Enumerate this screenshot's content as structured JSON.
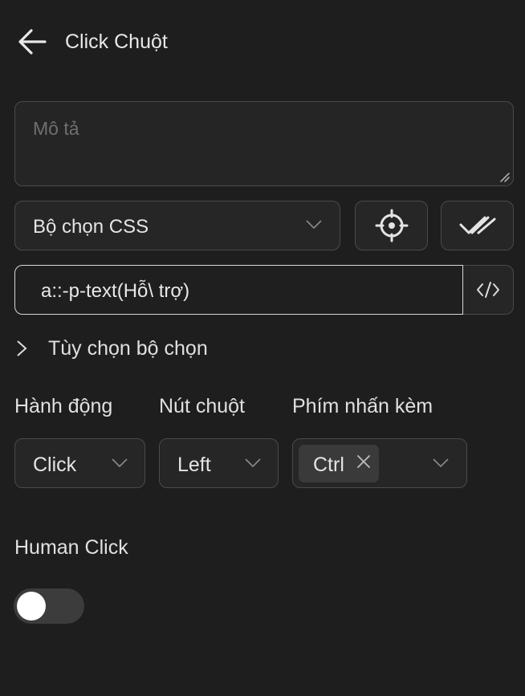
{
  "header": {
    "title": "Click Chuột",
    "back_icon": "arrow-left-icon"
  },
  "description": {
    "placeholder": "Mô tả",
    "value": ""
  },
  "selector": {
    "type_value": "Bộ chọn CSS",
    "css_value": "a::-p-text(Hỗ\\ trợ)",
    "pick_icon": "crosshair-icon",
    "verify_icon": "double-check-icon",
    "code_icon": "code-icon"
  },
  "selector_options": {
    "label": "Tùy chọn bộ chọn"
  },
  "action": {
    "label": "Hành động",
    "value": "Click"
  },
  "mouse_button": {
    "label": "Nút chuột",
    "value": "Left"
  },
  "modifier_keys": {
    "label": "Phím nhấn kèm",
    "tags": [
      "Ctrl"
    ]
  },
  "human_click": {
    "label": "Human Click",
    "enabled": false
  },
  "colors": {
    "background": "#1e1e1e",
    "border": "#4a4a4a",
    "active_border": "#d8d8d8"
  }
}
